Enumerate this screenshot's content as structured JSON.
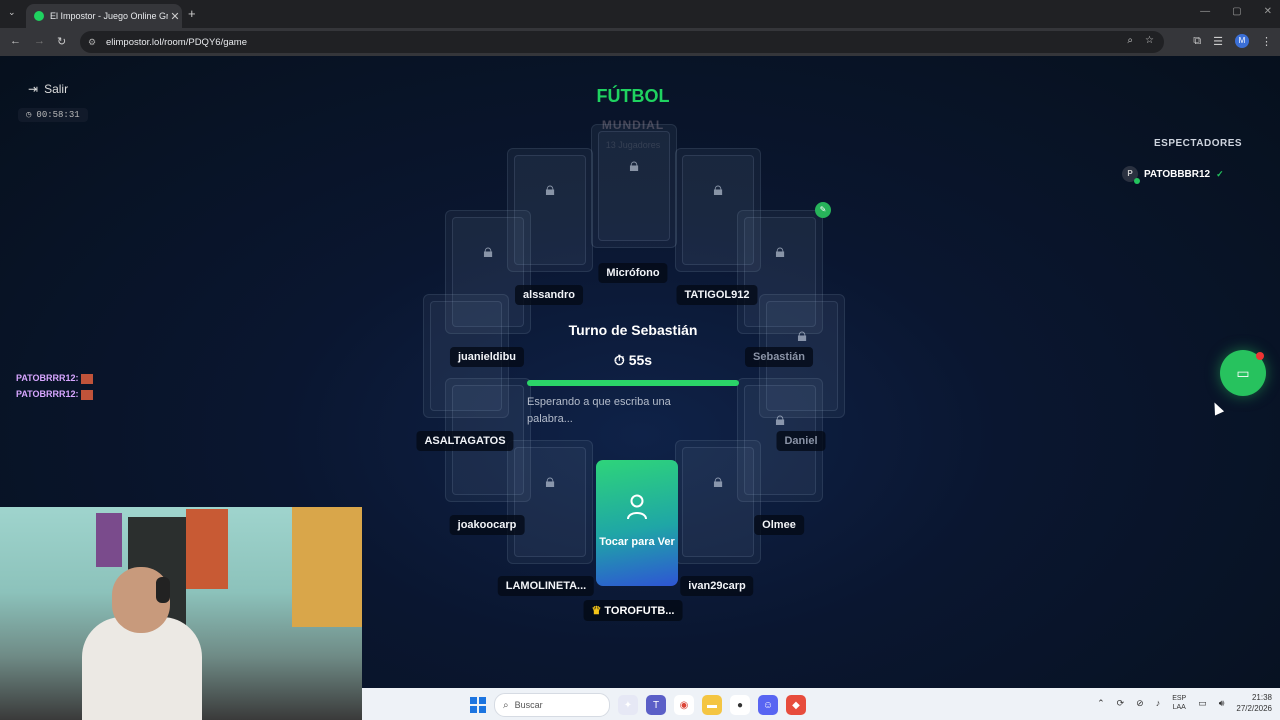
{
  "browser": {
    "tab_title": "El Impostor - Juego Online Gra",
    "tab_close": "✕",
    "new_tab": "+",
    "url": "elimpostor.lol/room/PDQY6/game",
    "profile_initial": "M"
  },
  "game": {
    "exit_label": "Salir",
    "timer": "00:58:31",
    "category": "FÚTBOL",
    "subcategory": "MUNDIAL",
    "players_count": "13 Jugadores",
    "turn_text": "Turno de Sebastián",
    "countdown": "55s",
    "turn_progress": 1.0,
    "waiting_text": "Esperando a que escriba una palabra...",
    "my_card_text": "Tocar para Ver",
    "host_name": "TOROFUTB...",
    "players": [
      "Micrófono",
      "alssandro",
      "TATIGOL912",
      "juanieldibu",
      "Sebastián",
      "ASALTAGATOS",
      "Daniel",
      "joakoocarp",
      "Olmee",
      "LAMOLINETA...",
      "ivan29carp"
    ]
  },
  "spectators": {
    "title": "ESPECTADORES",
    "list": [
      {
        "initial": "P",
        "name": "PATOBBBR12"
      }
    ]
  },
  "chat": {
    "messages": [
      {
        "user": "PATOBRRR12:"
      },
      {
        "user": "PATOBRRR12:"
      }
    ]
  },
  "taskbar": {
    "search_placeholder": "Buscar",
    "lang_1": "ESP",
    "lang_2": "LAA",
    "time": "21:38",
    "date": "27/2/2026"
  },
  "colors": {
    "accent_green": "#1fd360",
    "progress_green": "#2bd468",
    "chat_user": "#d7a6ff",
    "page_bg": "#0a1630"
  }
}
